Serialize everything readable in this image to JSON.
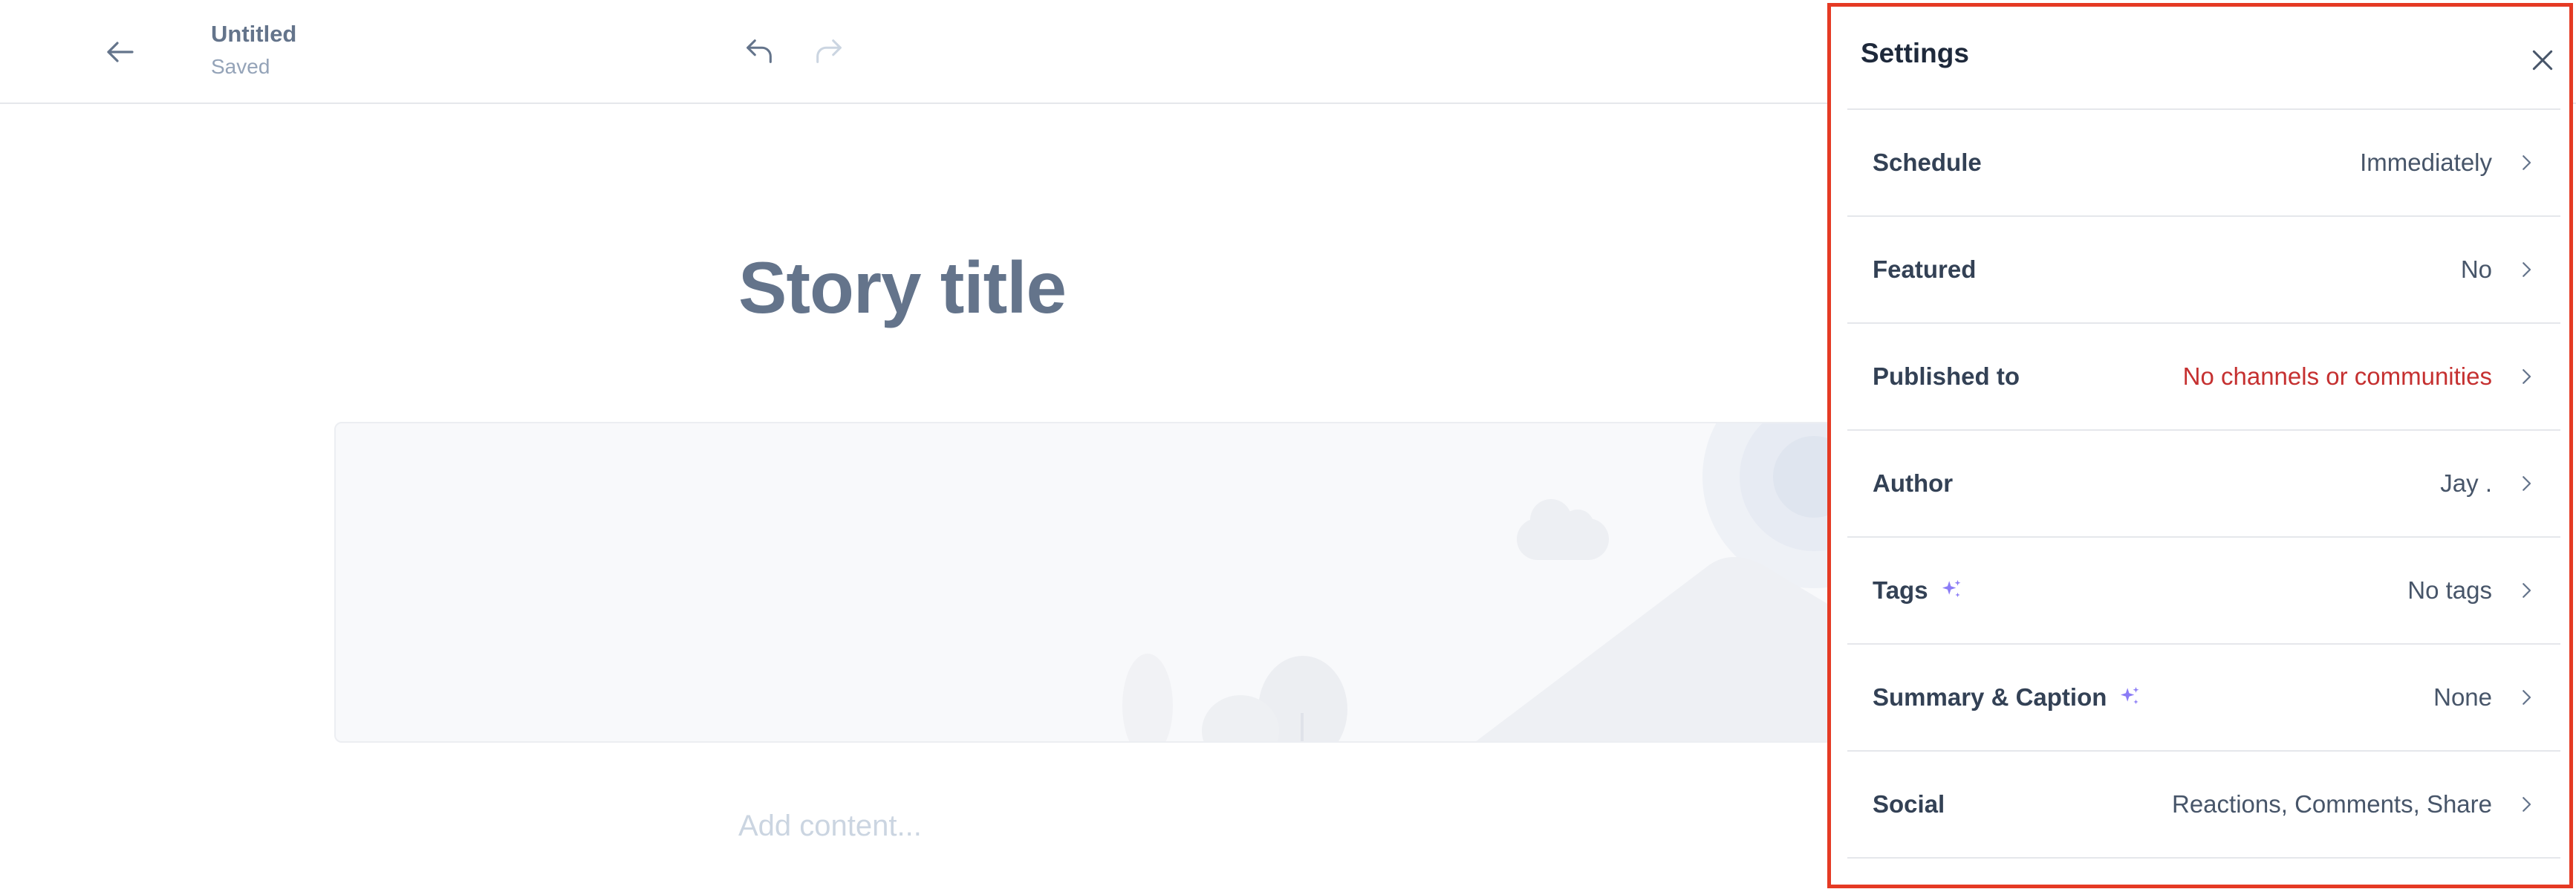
{
  "header": {
    "doc_title": "Untitled",
    "doc_status": "Saved",
    "icons": {
      "back": "arrow-left-icon",
      "undo": "undo-icon",
      "redo": "redo-icon"
    }
  },
  "editor": {
    "story_title": "Story title",
    "content_placeholder": "Add content..."
  },
  "settings": {
    "title": "Settings",
    "close_icon": "close-icon",
    "rows": [
      {
        "label": "Schedule",
        "value": "Immediately",
        "ai": false
      },
      {
        "label": "Featured",
        "value": "No",
        "ai": false
      },
      {
        "label": "Published to",
        "value": "No channels or communities",
        "ai": false,
        "status": "warning"
      },
      {
        "label": "Author",
        "value": "Jay .",
        "ai": false
      },
      {
        "label": "Tags",
        "value": "No tags",
        "ai": true
      },
      {
        "label": "Summary & Caption",
        "value": "None",
        "ai": true
      },
      {
        "label": "Social",
        "value": "Reactions, Comments, Share",
        "ai": false
      }
    ]
  },
  "colors": {
    "panel_border": "#e53a24",
    "warning_text": "#c53030",
    "sparkle": "#8b7cf6",
    "title_text": "#64748b"
  }
}
